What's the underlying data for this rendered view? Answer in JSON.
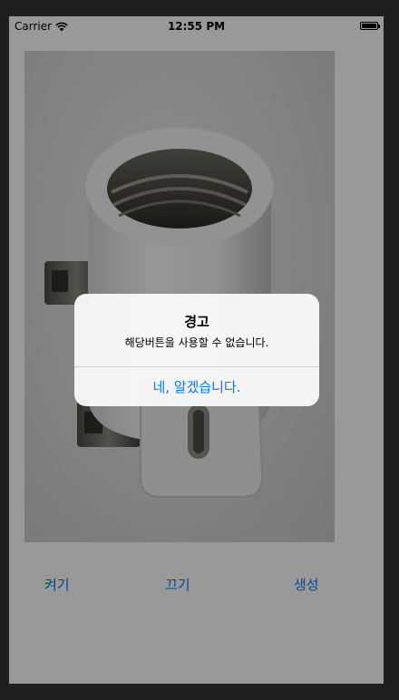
{
  "status_bar": {
    "carrier": "Carrier",
    "time": "12:55 PM"
  },
  "photo": {
    "icon": "lamp-socket-photo"
  },
  "buttons": {
    "on_label": "켜기",
    "off_label": "끄기",
    "create_label": "생성"
  },
  "alert": {
    "title": "경고",
    "message": "해당버튼을 사용할 수 없습니다.",
    "confirm_label": "네, 알겠습니다."
  },
  "colors": {
    "accent": "#007aff",
    "overlay": "#000000"
  }
}
